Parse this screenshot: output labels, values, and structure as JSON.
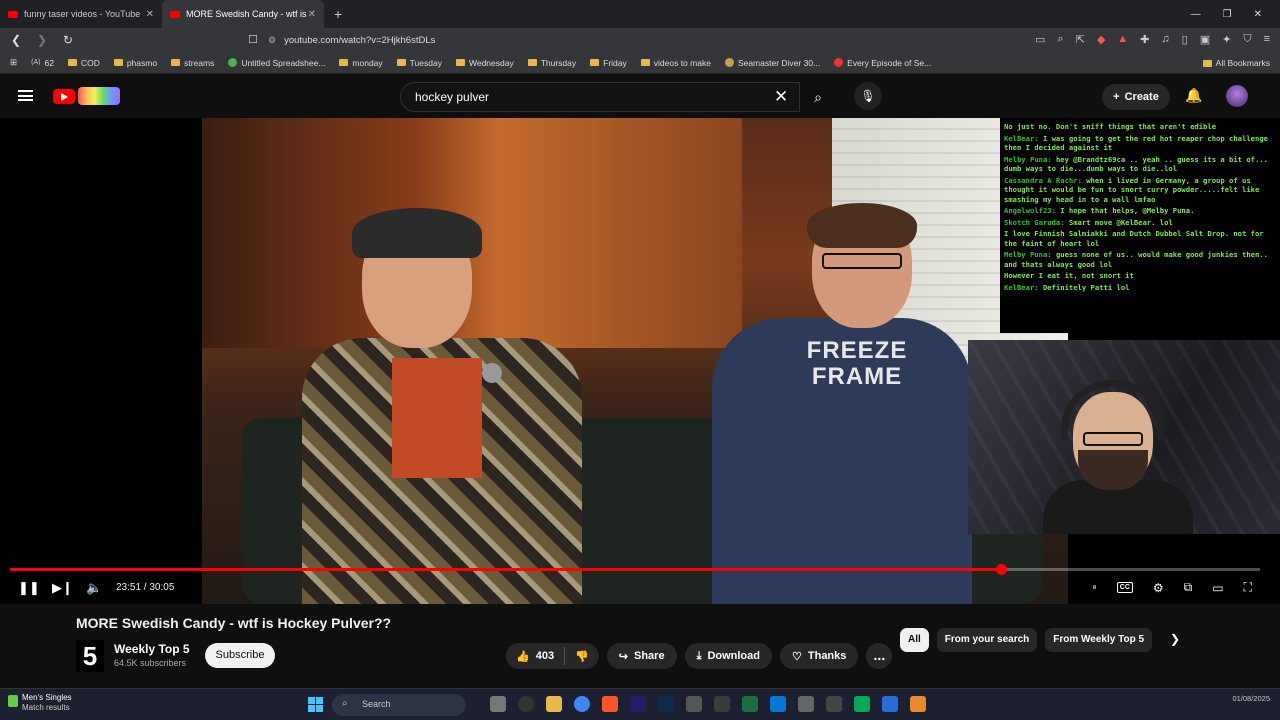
{
  "browser": {
    "tabs": [
      {
        "title": "funny taser videos - YouTube",
        "active": false
      },
      {
        "title": "MORE Swedish Candy - wtf is",
        "active": true
      }
    ],
    "url": "youtube.com/watch?v=2Hjkh6stDLs",
    "bookmarks": [
      "62",
      "COD",
      "phasmo",
      "streams",
      "Untitled Spreadshee...",
      "monday",
      "Tuesday",
      "Wednesday",
      "Thursday",
      "Friday",
      "videos to make",
      "Seamaster Diver 30...",
      "Every Episode of Se..."
    ],
    "all_bookmarks": "All Bookmarks"
  },
  "youtube": {
    "search_value": "hockey pulver",
    "create_label": "Create"
  },
  "overlay": {
    "shirt_text_line1": "FREEZE",
    "shirt_text_line2": "FRAME",
    "chat": [
      {
        "user": "",
        "msg": "No just no. Don't sniff things that aren't edible"
      },
      {
        "user": "KelBear:",
        "msg": "I was going to get the red hot reaper chop challenge then I decided against it"
      },
      {
        "user": "Melby Puna:",
        "msg": "hey @Brandtz69ca .. yeah .. guess its a bit of... dumb ways to die...dumb ways to die..lol"
      },
      {
        "user": "Cassandra A Rachr:",
        "msg": "when i lived in Germany, a group of us thought it would be fun to snort curry powder.....felt like smashing my head in to a wall lmfao"
      },
      {
        "user": "Angelwolf23:",
        "msg": "I hope that helps, @Melby Puna."
      },
      {
        "user": "Skotch Garuda:",
        "msg": "Smart move @KelBear. lol"
      },
      {
        "user": "",
        "msg": "I love Finnish Salmiakki and Dutch Dubbel Salt Drop. not for the faint of heart lol"
      },
      {
        "user": "Melby Puna:",
        "msg": "guess none of us.. would make good junkies then.. and thats always good lol"
      },
      {
        "user": "",
        "msg": "However I eat it, not snort it"
      },
      {
        "user": "KelBear:",
        "msg": "Definitely Patti lol"
      }
    ]
  },
  "player": {
    "time": "23:51 / 30:05",
    "progress_fraction": 0.793
  },
  "video": {
    "title": "MORE Swedish Candy - wtf is Hockey Pulver??",
    "channel_logo": "5",
    "channel": "Weekly Top 5",
    "subscribers": "64.5K subscribers",
    "subscribe_label": "Subscribe",
    "likes": "403",
    "share_label": "Share",
    "download_label": "Download",
    "thanks_label": "Thanks",
    "more_label": "..."
  },
  "chips": [
    {
      "label": "All",
      "selected": true
    },
    {
      "label": "From your search",
      "selected": false
    },
    {
      "label": "From Weekly Top 5",
      "selected": false
    }
  ],
  "taskbar": {
    "news_title": "Men's Singles",
    "news_sub": "Match results",
    "search_placeholder": "Search",
    "date": "01/08/2025"
  },
  "colors": {
    "accent_red": "#ff0000",
    "chat_green": "#7de84a",
    "background": "#0f0f0f"
  }
}
